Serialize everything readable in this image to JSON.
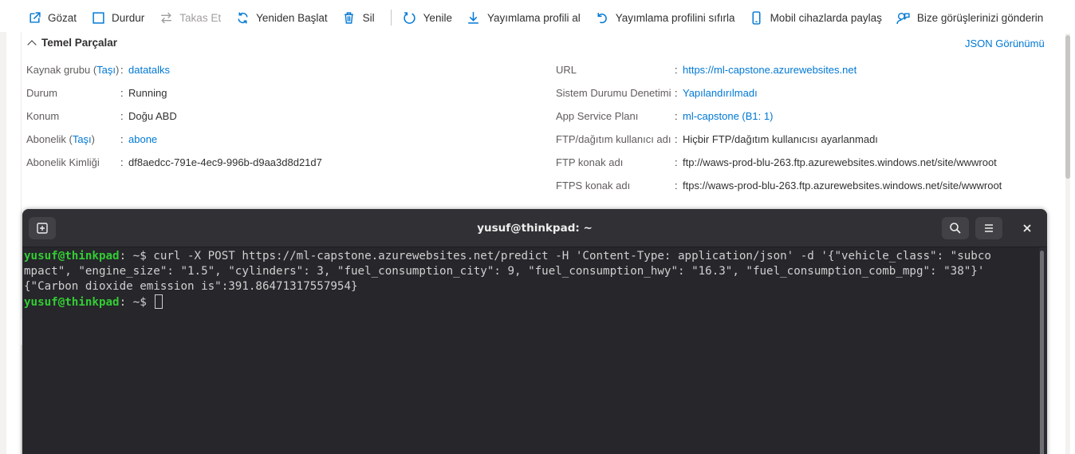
{
  "toolbar": {
    "browse": "Gözat",
    "stop": "Durdur",
    "swap": "Takas Et",
    "restart": "Yeniden Başlat",
    "delete": "Sil",
    "refresh": "Yenile",
    "get_publish_profile": "Yayımlama profili al",
    "reset_publish_profile": "Yayımlama profilini sıfırla",
    "share_mobile": "Mobil cihazlarda paylaş",
    "feedback": "Bize görüşlerinizi gönderin"
  },
  "essentials": {
    "title": "Temel Parçalar",
    "json_view": "JSON Görünümü",
    "left": [
      {
        "label": "Kaynak grubu (",
        "label_link": "Taşı",
        "label_end": ")",
        "value": "datatalks",
        "is_link": true
      },
      {
        "label": "Durum",
        "value": "Running",
        "is_link": false
      },
      {
        "label": "Konum",
        "value": "Doğu ABD",
        "is_link": false
      },
      {
        "label": "Abonelik (",
        "label_link": "Taşı",
        "label_end": ")",
        "value": "abone",
        "is_link": true
      },
      {
        "label": "Abonelik Kimliği",
        "value": "df8aedcc-791e-4ec9-996b-d9aa3d8d21d7",
        "is_link": false
      }
    ],
    "right": [
      {
        "label": "URL",
        "value": "https://ml-capstone.azurewebsites.net",
        "is_link": true
      },
      {
        "label": "Sistem Durumu Denetimi",
        "value": "Yapılandırılmadı",
        "is_link": true
      },
      {
        "label": "App Service Planı",
        "value": "ml-capstone (B1: 1)",
        "is_link": true
      },
      {
        "label": "FTP/dağıtım kullanıcı adı",
        "value": "Hiçbir FTP/dağıtım kullanıcısı ayarlanmadı",
        "is_link": false
      },
      {
        "label": "FTP konak adı",
        "value": "ftp://waws-prod-blu-263.ftp.azurewebsites.windows.net/site/wwwroot",
        "is_link": false
      },
      {
        "label": "FTPS konak adı",
        "value": "ftps://waws-prod-blu-263.ftp.azurewebsites.windows.net/site/wwwroot",
        "is_link": false
      }
    ],
    "colon": ":"
  },
  "terminal": {
    "title": "yusuf@thinkpad: ~",
    "prompt_user": "yusuf@thinkpad",
    "prompt_path": ": ~",
    "prompt_symbol": "$",
    "command_line1": " curl -X POST https://ml-capstone.azurewebsites.net/predict -H 'Content-Type: application/json' -d '{\"vehicle_class\": \"subco",
    "command_line2": "mpact\", \"engine_size\": \"1.5\", \"cylinders\": 3, \"fuel_consumption_city\": 9, \"fuel_consumption_hwy\": \"16.3\", \"fuel_consumption_comb_mpg\": \"38\"}'",
    "output": "{\"Carbon dioxide emission is\":391.86471317557954}"
  },
  "colors": {
    "link": "#0078d4",
    "terminal_bg": "#26262b",
    "prompt_green": "#33cc33"
  }
}
